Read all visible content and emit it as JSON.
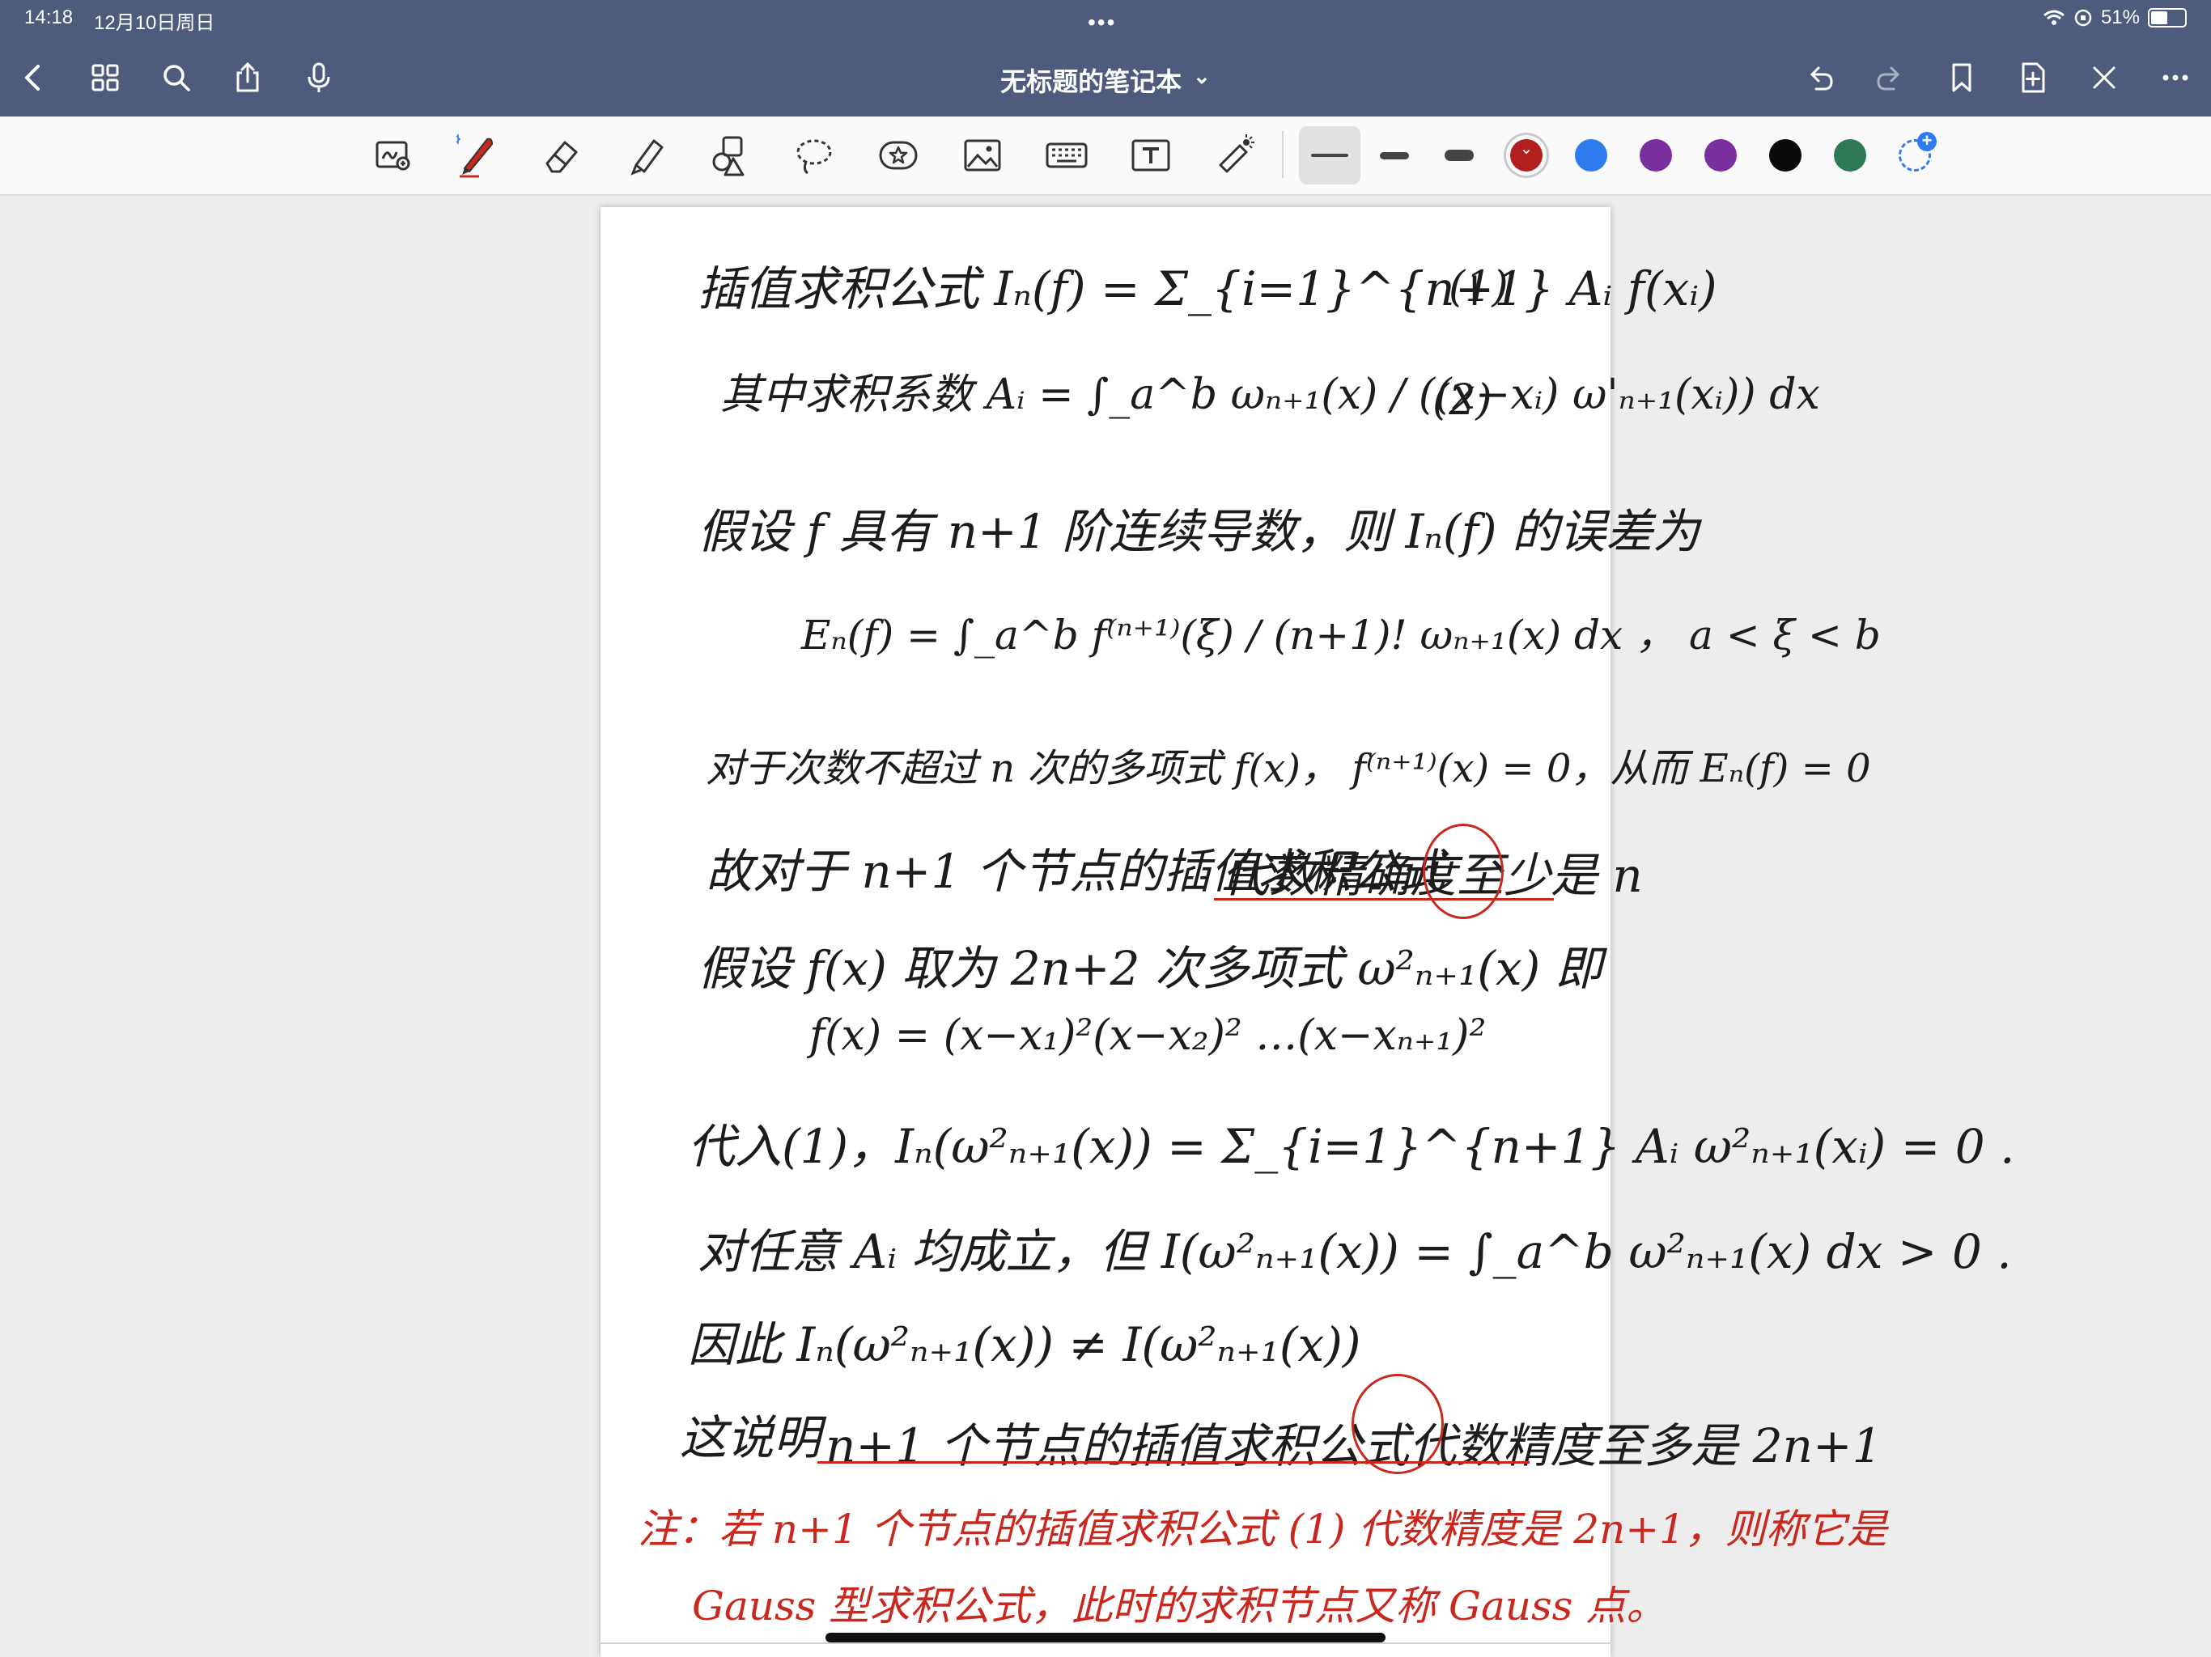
{
  "status_bar": {
    "time": "14:18",
    "date": "12月10日周日",
    "battery_percent": "51%",
    "battery_level": 0.51,
    "more": "•••"
  },
  "nav_bar": {
    "title": "无标题的笔记本",
    "title_chevron": "⌄"
  },
  "toolbar": {
    "tools": [
      "zoom-window-icon",
      "pen-icon",
      "eraser-icon",
      "highlighter-icon",
      "shapes-icon",
      "lasso-icon",
      "sticker-icon",
      "image-icon",
      "keyboard-icon",
      "text-box-icon",
      "laser-pointer-icon"
    ],
    "selected_tool": "pen-icon",
    "stroke_widths": [
      "thin",
      "medium",
      "thick"
    ],
    "selected_stroke": "thin",
    "colors": [
      "#b21f1f",
      "#2f7bf0",
      "#7a2f9e",
      "#7a2f9e",
      "#0a0a0a",
      "#2e7a56"
    ],
    "selected_color": "#b21f1f",
    "add_color_label": "+"
  },
  "note": {
    "lines": [
      "插值求积公式  Iₙ(f) = Σ_{i=1}^{n+1} Aᵢ f(xᵢ)",
      "(1)",
      "其中求积系数  Aᵢ = ∫_a^b  ωₙ₊₁(x) / ((x−xᵢ) ω'ₙ₊₁(xᵢ))  dx",
      "(2)",
      "假设 f 具有 n+1 阶连续导数，则 Iₙ(f) 的误差为",
      "Eₙ(f) = ∫_a^b  f⁽ⁿ⁺¹⁾(ξ) / (n+1)!  ωₙ₊₁(x) dx ，  a < ξ < b",
      "对于次数不超过 n 次的多项式 f(x)， f⁽ⁿ⁺¹⁾(x) = 0，从而 Eₙ(f) = 0",
      "故对于 n+1 个节点的插值求积公式",
      "代数精确度至少是 n",
      "假设 f(x) 取为 2n+2 次多项式  ω²ₙ₊₁(x)  即",
      "f(x) = (x−x₁)²(x−x₂)² …(x−xₙ₊₁)²",
      "代入(1)，Iₙ(ω²ₙ₊₁(x)) = Σ_{i=1}^{n+1} Aᵢ ω²ₙ₊₁(xᵢ) = 0 .",
      "对任意 Aᵢ 均成立，但  I(ω²ₙ₊₁(x)) = ∫_a^b ω²ₙ₊₁(x) dx > 0 .",
      "因此  Iₙ(ω²ₙ₊₁(x)) ≠ I(ω²ₙ₊₁(x))",
      "这说明",
      "n+1 个节点的插值求积公式代数精度至多是 2n+1"
    ],
    "annotation": [
      "注：若 n+1 个节点的插值求积公式 (1) 代数精度是 2n+1，则称它是",
      "Gauss 型求积公式，此时的求积节点又称 Gauss 点。"
    ]
  }
}
